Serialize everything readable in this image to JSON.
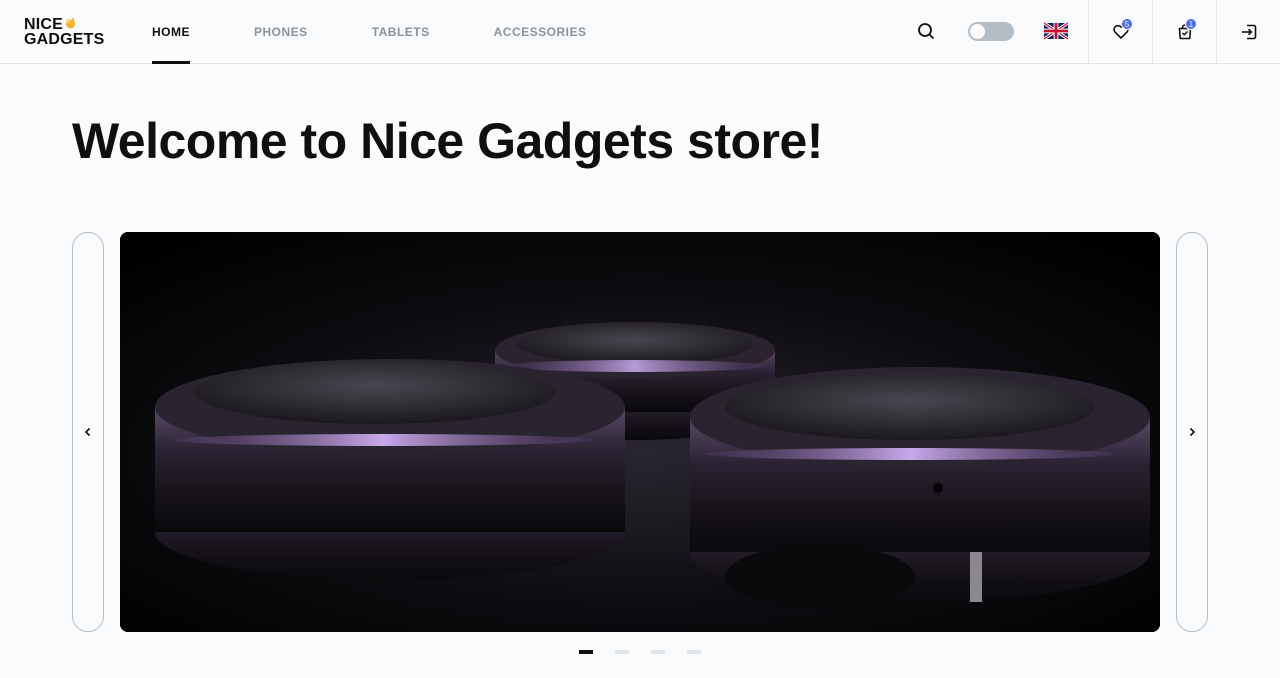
{
  "logo": {
    "line1": "NICE",
    "line2": "GADGETS"
  },
  "nav": {
    "items": [
      {
        "label": "HOME",
        "active": true
      },
      {
        "label": "PHONES",
        "active": false
      },
      {
        "label": "TABLETS",
        "active": false
      },
      {
        "label": "ACCESSORIES",
        "active": false
      }
    ]
  },
  "header": {
    "search_icon": "search-icon",
    "theme_toggle": "off",
    "language_flag": "uk-flag-icon",
    "favourites_count": "5",
    "cart_count": "1",
    "logout_icon": "logout-icon"
  },
  "main": {
    "title": "Welcome to Nice Gadgets store!"
  },
  "slider": {
    "prev_icon": "chevron-left-icon",
    "next_icon": "chevron-right-icon",
    "slides": 4,
    "active_slide": 1
  },
  "colors": {
    "accent": "#4a6cf7",
    "text": "#0f0f11",
    "muted": "#89939a",
    "border": "#e2e6e9"
  }
}
